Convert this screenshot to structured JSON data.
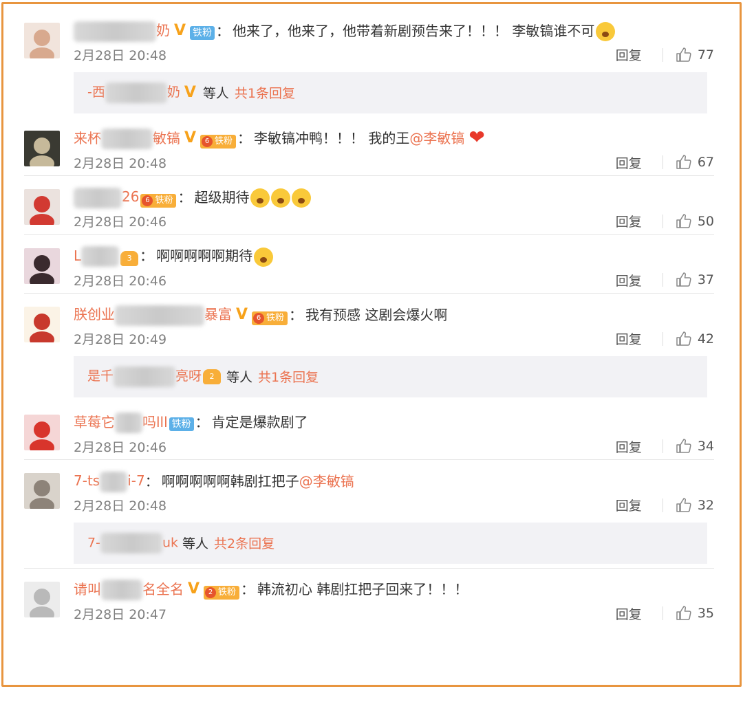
{
  "comments": [
    {
      "name_pre": "",
      "name_post": "奶",
      "blur_w": 120,
      "verified": true,
      "badge_type": "fan",
      "badge_text": "铁粉",
      "badge_level": "",
      "text": "他来了，他来了，他带着新剧预告来了！！！ 李敏镐谁不可",
      "mention": "",
      "emoji": "crying-emoji",
      "time": "2月28日 20:48",
      "reply_label": "回复",
      "likes": "77",
      "replies": {
        "name_pre": "-西",
        "name_post": "奶",
        "verified": true,
        "crown": false,
        "crown_level": "",
        "etc": "等人",
        "count": "共1条回复"
      },
      "avatar": {
        "bg": "#f1e4dc",
        "fg": "#d8a98e"
      }
    },
    {
      "name_pre": "来杯",
      "name_post": "敏镐",
      "blur_w": 75,
      "verified": true,
      "badge_type": "crown",
      "badge_text": "铁粉",
      "badge_level": "6",
      "text": "李敏镐冲鸭！！！ 我的王",
      "mention": "@李敏镐",
      "emoji": "heart",
      "time": "2月28日 20:48",
      "reply_label": "回复",
      "likes": "67",
      "replies": null,
      "avatar": {
        "bg": "#3a3a32",
        "fg": "#c6b99a"
      }
    },
    {
      "name_pre": "",
      "name_post": "26",
      "blur_w": 70,
      "verified": false,
      "badge_type": "crown",
      "badge_text": "铁粉",
      "badge_level": "6",
      "text": "超级期待",
      "mention": "",
      "emoji": "shocked-emoji-x3",
      "time": "2月28日 20:46",
      "reply_label": "回复",
      "likes": "50",
      "replies": null,
      "avatar": {
        "bg": "#ebe2de",
        "fg": "#d23a32"
      }
    },
    {
      "name_pre": "L",
      "name_post": "",
      "blur_w": 55,
      "verified": false,
      "badge_type": "crownsolo",
      "badge_text": "",
      "badge_level": "3",
      "text": "啊啊啊啊啊期待",
      "mention": "",
      "emoji": "face-emoji",
      "time": "2月28日 20:46",
      "reply_label": "回复",
      "likes": "37",
      "replies": null,
      "avatar": {
        "bg": "#e9d7dd",
        "fg": "#3a2a2e"
      }
    },
    {
      "name_pre": "朕创业",
      "name_post": "暴富",
      "blur_w": 130,
      "verified": true,
      "badge_type": "crown",
      "badge_text": "铁粉",
      "badge_level": "6",
      "text": "我有预感 这剧会爆火啊",
      "mention": "",
      "emoji": "",
      "time": "2月28日 20:49",
      "reply_label": "回复",
      "likes": "42",
      "replies": {
        "name_pre": "是千",
        "name_post": "亮呀",
        "verified": false,
        "crown": true,
        "crown_level": "2",
        "etc": "等人",
        "count": "共1条回复"
      },
      "avatar": {
        "bg": "#fbf3e6",
        "fg": "#c8392d"
      }
    },
    {
      "name_pre": "草莓它",
      "name_post": "吗lll",
      "blur_w": 40,
      "verified": false,
      "badge_type": "fan",
      "badge_text": "铁粉",
      "badge_level": "",
      "text": "肯定是爆款剧了",
      "mention": "",
      "emoji": "",
      "time": "2月28日 20:46",
      "reply_label": "回复",
      "likes": "34",
      "replies": null,
      "avatar": {
        "bg": "#f5d6d6",
        "fg": "#d8352c"
      }
    },
    {
      "name_pre": "7-ts",
      "name_post": "i-7",
      "blur_w": 40,
      "verified": false,
      "badge_type": "",
      "badge_text": "",
      "badge_level": "",
      "text": "啊啊啊啊啊韩剧扛把子",
      "mention": "@李敏镐",
      "emoji": "",
      "time": "2月28日 20:48",
      "reply_label": "回复",
      "likes": "32",
      "replies": {
        "name_pre": "7-",
        "name_post": "uk",
        "verified": false,
        "crown": false,
        "crown_level": "",
        "etc": "等人",
        "count": "共2条回复"
      },
      "avatar": {
        "bg": "#d9d3cb",
        "fg": "#8d8379"
      }
    },
    {
      "name_pre": "请叫",
      "name_post": "名全名",
      "blur_w": 60,
      "verified": true,
      "badge_type": "crown",
      "badge_text": "铁粉",
      "badge_level": "2",
      "text": "韩流初心 韩剧扛把子回来了！！！",
      "mention": "",
      "emoji": "",
      "time": "2月28日 20:47",
      "reply_label": "回复",
      "likes": "35",
      "replies": null,
      "avatar": {
        "bg": "#ececec",
        "fg": "#b9b9b9"
      }
    }
  ],
  "colors": {
    "frame": "#e8953f",
    "link": "#eb7350",
    "fan_badge": "#5cb0e8",
    "crown_badge": "#f8ae39"
  }
}
